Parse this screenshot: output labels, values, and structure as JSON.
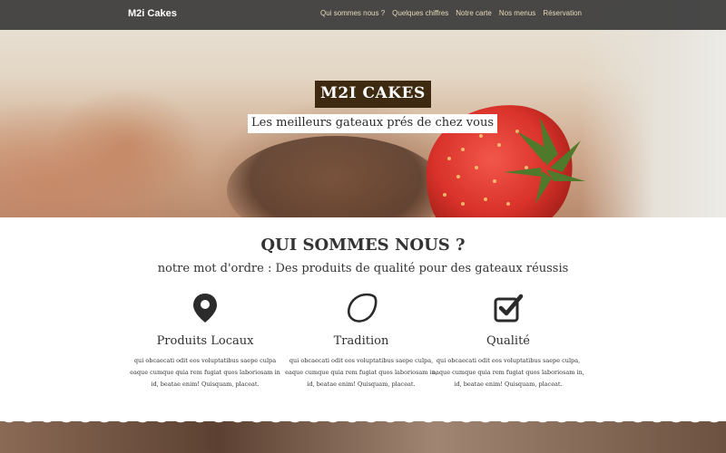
{
  "nav": {
    "brand": "M2i Cakes",
    "links": [
      "Qui sommes nous ?",
      "Quelques chiffres",
      "Notre carte",
      "Nos menus",
      "Réservation"
    ]
  },
  "hero": {
    "title": "M2I CAKES",
    "subtitle": "Les meilleurs gateaux prés de chez vous"
  },
  "about": {
    "title": "QUI SOMMES NOUS ?",
    "subtitle": "notre mot d'ordre : Des produits de qualité pour des gateaux réussis",
    "features": [
      {
        "icon": "map-marker-icon",
        "title": "Produits Locaux",
        "text": "qui obcaecati odit eos voluptatibus saepe culpa eaque cumque quia rem fugiat quos laboriosam in id, beatae enim! Quisquam, placeat."
      },
      {
        "icon": "lemon-icon",
        "title": "Tradition",
        "text": "qui obcaecati odit eos voluptatibus saepe culpa, eaque cumque quia rem fugiat quos laboriosam in, id, beatae enim! Quisquam, placeat."
      },
      {
        "icon": "check-square-icon",
        "title": "Qualité",
        "text": "qui obcaecati odit eos voluptatibus saepe culpa, eaque cumque quia rem fugiat quos laboriosam in, id, beatae enim! Quisquam, placeat."
      }
    ]
  },
  "colors": {
    "navbar": "#3a3a3a",
    "nav_link": "#e8d8b8",
    "title_badge": "#3d2a10",
    "strawberry": "#d9322a"
  }
}
